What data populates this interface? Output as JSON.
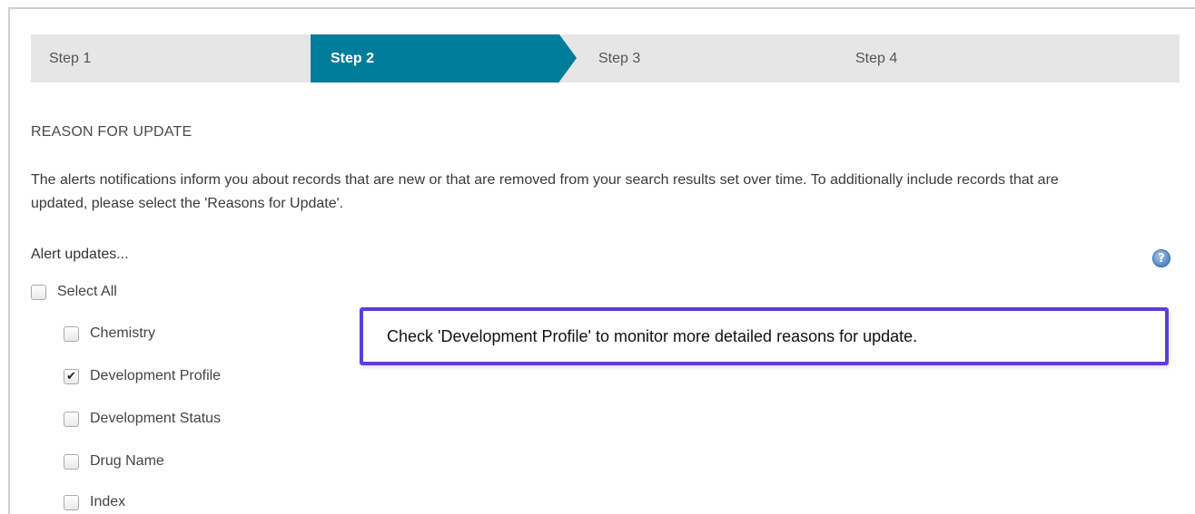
{
  "steps": [
    {
      "label": "Step 1"
    },
    {
      "label": "Step 2"
    },
    {
      "label": "Step 3"
    },
    {
      "label": "Step 4"
    }
  ],
  "section_title": "REASON FOR UPDATE",
  "intro_text": "The alerts notifications inform you about records that are new or that are removed from your search results set over time. To additionally include records that are updated, please select the 'Reasons for Update'.",
  "alert_updates_label": "Alert updates...",
  "help_icon": "question-circle-icon",
  "select_all": {
    "label": "Select All",
    "checked": false
  },
  "options": [
    {
      "label": "Chemistry",
      "checked": false
    },
    {
      "label": "Development Profile",
      "checked": true
    },
    {
      "label": "Development Status",
      "checked": false
    },
    {
      "label": "Drug Name",
      "checked": false
    },
    {
      "label": "Index",
      "checked": false
    }
  ],
  "callout_text": "Check 'Development Profile' to monitor more detailed reasons for update.",
  "colors": {
    "active_step": "#007d99",
    "step_bar": "#e6e6e6",
    "callout_border": "#5b3fd6"
  }
}
